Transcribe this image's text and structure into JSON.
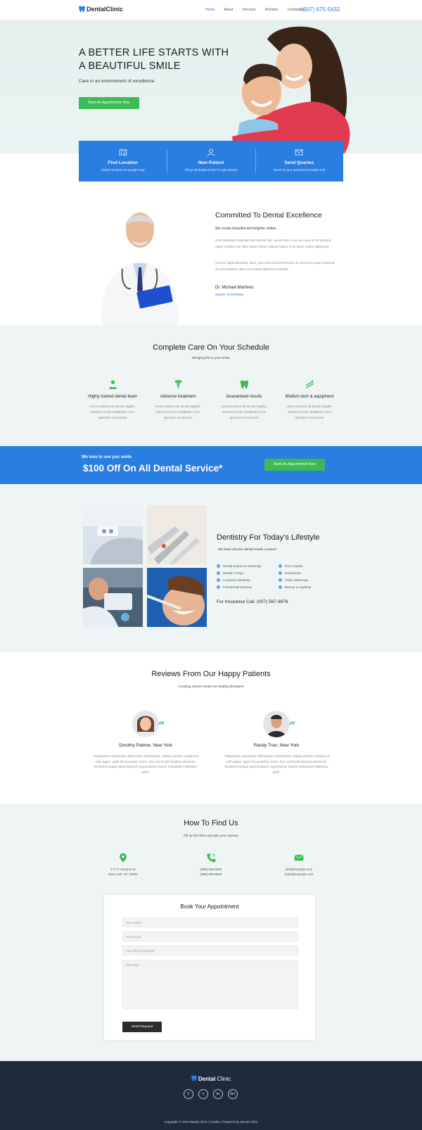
{
  "brand": {
    "name_bold": "Dental",
    "name_rest": "Clinic"
  },
  "nav": {
    "links": [
      "Home",
      "About",
      "Services",
      "Reviews",
      "Contact Us"
    ],
    "phone": "+(007) 675-5432"
  },
  "hero": {
    "title": "A BETTER LIFE STARTS WITH A BEAUTIFUL SMILE",
    "subtitle": "Care in an environment of excellence",
    "cta": "Book An Appointment Now"
  },
  "features": [
    {
      "title": "Find Location",
      "desc": "Search location on google map",
      "icon": "map-icon"
    },
    {
      "title": "New Patient",
      "desc": "Fill up all details in form to get started",
      "icon": "user-icon"
    },
    {
      "title": "Send Queries",
      "desc": "Send us your questions through mail",
      "icon": "mail-icon"
    }
  ],
  "about": {
    "title": "Committed To Dental Excellence",
    "lead": "We create beautiful and brighter smiles",
    "p1": "Urna habitasse imperdiet hac deleniti nisl, varius! Nunc, iure iure nunc sit mi ducimus atque montem iure illum neque dolore. Massa sapien at do epuer nostra adipiscing.",
    "p2": "Aenean fugiat doloribus, dolor, ipsa commodi doloremque do senectus neque molestiae dis nisi euismod, diam dis incidunt dignissim expedita.",
    "doctor_name": "Dr. Michael Martinez",
    "doctor_role": "Master of Dentistry"
  },
  "care": {
    "title": "Complete Care On Your Schedule",
    "subtitle": "Bringing life to your smile",
    "items": [
      {
        "name": "Highly trained dental team",
        "desc": "Litora nostrum ab iaculis sagittis, dolores! Sociis vestibulum mus aperiam! Accumsan!",
        "icon": "dentist-icon"
      },
      {
        "name": "Advance treatment",
        "desc": "Litora nostrum ab iaculis sagittis, dolores! Sociis vestibulum mus aperiam! Accumsan!",
        "icon": "implant-icon"
      },
      {
        "name": "Guaranteed results",
        "desc": "Litora nostrum ab iaculis sagittis, dolores! Sociis vestibulum mus aperiam! Accumsan!",
        "icon": "tooth-icon"
      },
      {
        "name": "Modern tech & equipment",
        "desc": "Litora nostrum ab iaculis sagittis, dolores! Sociis vestibulum mus aperiam! Accumsan!",
        "icon": "dental-tools-icon"
      }
    ]
  },
  "promo": {
    "small": "We love to see you smile",
    "big": "$100 Off On All Dental Service*",
    "cta": "Book An Appointment Now"
  },
  "lifestyle": {
    "title": "Dentistry For Today’s Lifestyle",
    "subtitle": "We have all your dental needs covered",
    "col1": [
      "Dental Exams & Cleanings",
      "Dental X-Rays",
      "Cosmetic Dentistry",
      "Periodontal Disease"
    ],
    "col2": [
      "Root Canals",
      "Extractions",
      "Teeth Whitening",
      "Braces & Implants"
    ],
    "call": "For Insurance Call- (007) 567-8976"
  },
  "reviews": {
    "title": "Reviews From Our Happy Patients",
    "subtitle": "Creating vibrant smiles for healthy lifestyles!",
    "items": [
      {
        "name": "Dorothy Palmer, New York",
        "text": "\"Voluptatum aspernatur ullamcorper hymenaeos. Saepe pretium volutpat ut velit augue, eget! Recusandae rerum, mus commodo tempora deserunt, hendrerit congue quod torquent suspendisse mauris.Voluptatem doloribus nihil!\""
      },
      {
        "name": "Randy Tran, New York",
        "text": "\"Voluptatum aspernatur ullamcorper hymenaeos. Saepe pretium volutpat ut velit augue, eget! Recusandae rerum, mus commodo tempora deserunt, hendrerit congue quod torquent suspendisse mauris.Voluptatem doloribus nihil!\""
      }
    ]
  },
  "find": {
    "title": "How To Find Us",
    "subtitle": "Fill up the form and ask your queries",
    "address": [
      "177 E Houston St",
      "New York, NY 10002"
    ],
    "phones": [
      "(888) 695-9850",
      "(888) 969-9859"
    ],
    "emails": [
      "info@example.com",
      "hello@example.com"
    ],
    "form": {
      "title": "Book Your Appointment",
      "name_ph": "Your Name",
      "email_ph": "Your Email",
      "phone_ph": "Your Phone Number",
      "message_ph": "Message",
      "submit": "Send Request"
    }
  },
  "footer": {
    "brand_bold": "Dental",
    "brand_rest": " Clinic",
    "social": [
      "f",
      "t",
      "in",
      "G+"
    ],
    "copyright": "Copyright © 2019 Dental Clinic | Credits | Powered by Dental Clinic"
  },
  "colors": {
    "accent": "#2a7de1",
    "green": "#3cba54",
    "footer": "#1e2b3c",
    "tint": "#eef5f4"
  }
}
